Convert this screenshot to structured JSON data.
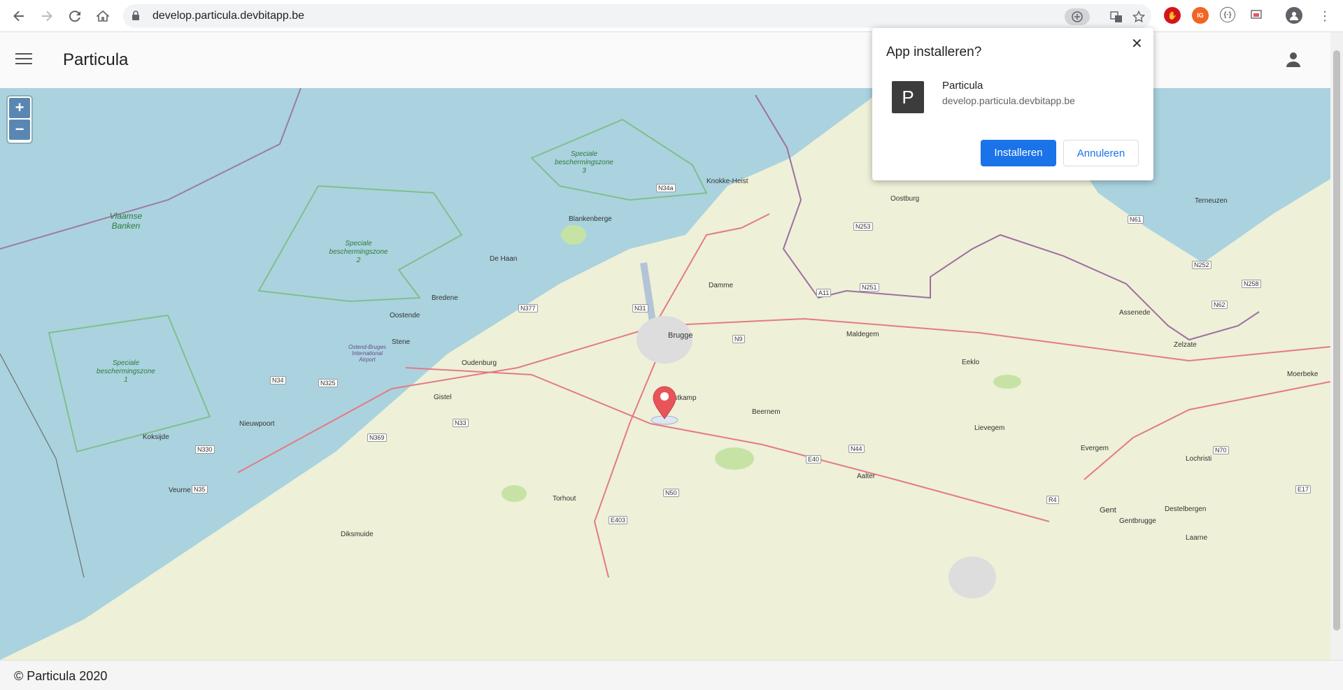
{
  "browser": {
    "url": "develop.particula.devbitapp.be",
    "back_icon": "arrow-left-icon",
    "forward_icon": "arrow-right-icon",
    "reload_icon": "reload-icon",
    "home_icon": "home-icon"
  },
  "app": {
    "title": "Particula",
    "menu_icon": "hamburger-menu-icon",
    "account_icon": "user-icon"
  },
  "map": {
    "zoom_in": "+",
    "zoom_out": "−",
    "sea_labels": [
      "Vlaamse Banken"
    ],
    "zone_labels": [
      {
        "line1": "Speciale",
        "line2": "beschermingszone",
        "line3": "2"
      },
      {
        "line1": "Speciale",
        "line2": "beschermingszone",
        "line3": "3"
      },
      {
        "line1": "Speciale",
        "line2": "beschermingszone",
        "line3": "1"
      }
    ],
    "places": [
      "Knokke-Heist",
      "Blankenberge",
      "De Haan",
      "Bredene",
      "Oostende",
      "Stene",
      "Oudenburg",
      "Damme",
      "Brugge",
      "Oostkamp",
      "Gistel",
      "Nieuwpoort",
      "Koksijde",
      "Veurne",
      "Diksmuide",
      "Torhout",
      "Beernem",
      "Maldegem",
      "Eeklo",
      "Aalter",
      "Lievegem",
      "Evergem",
      "Gent",
      "Oostburg",
      "Terneuzen",
      "Assenede",
      "Zelzate",
      "Moerbeke",
      "Lochristi",
      "Destelbergen",
      "Gentbrugge",
      "Laarne"
    ],
    "roads": [
      "N34a",
      "N31",
      "N377",
      "N9",
      "N34",
      "N325",
      "N33",
      "N369",
      "N330",
      "N35",
      "N50",
      "E403",
      "N44",
      "E40",
      "N253",
      "N251",
      "A11",
      "N61",
      "N252",
      "N258",
      "N62",
      "N70",
      "E17",
      "R4"
    ],
    "airport": "Ostend-Bruges International Airport"
  },
  "footer": {
    "text": "© Particula 2020"
  },
  "install_dialog": {
    "title": "App installeren?",
    "close_icon": "close-icon",
    "app_icon_letter": "P",
    "app_name": "Particula",
    "app_url": "develop.particula.devbitapp.be",
    "install_label": "Installeren",
    "cancel_label": "Annuleren"
  },
  "colors": {
    "sea": "#aad3df",
    "land": "#eef0d8",
    "primary_button": "#1a73e8",
    "marker": "#e8545a"
  }
}
